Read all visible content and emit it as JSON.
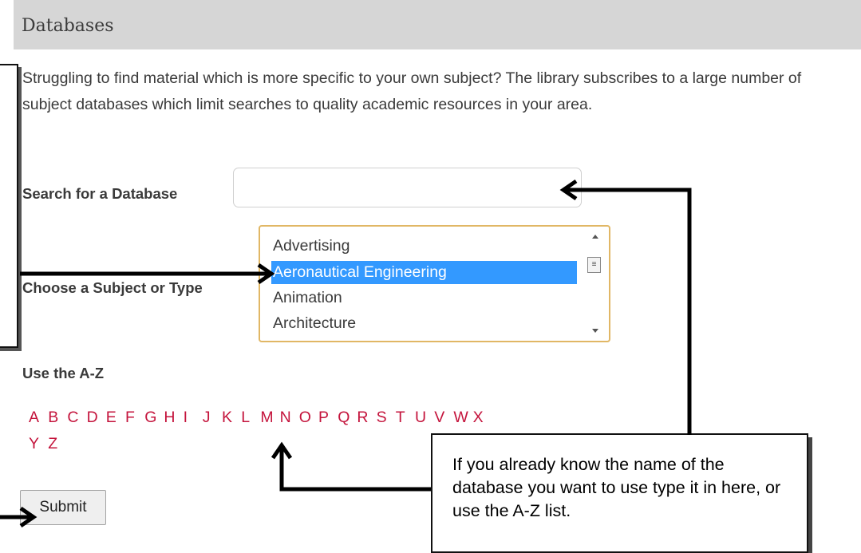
{
  "header": {
    "title": "Databases"
  },
  "intro": "Struggling to find material which is more specific to your own subject? The library subscribes to a large number of subject databases which limit searches to quality academic resources in your area.",
  "search": {
    "label": "Search for a Database",
    "value": "",
    "placeholder": ""
  },
  "subject": {
    "label": "Choose a Subject or Type",
    "options": [
      "Advertising",
      "Aeronautical Engineering",
      "Animation",
      "Architecture"
    ],
    "selected": "Aeronautical Engineering"
  },
  "az": {
    "label": "Use the A-Z",
    "letters": [
      "A",
      "B",
      "C",
      "D",
      "E",
      "F",
      "G",
      "H",
      "I",
      "J",
      "K",
      "L",
      "M",
      "N",
      "O",
      "P",
      "Q",
      "R",
      "S",
      "T",
      "U",
      "V",
      "W",
      "X",
      "Y",
      "Z"
    ]
  },
  "submit_label": "Submit",
  "callout": {
    "text": "If you already know the name of the database you want to use type it in here, or use the A-Z list."
  },
  "colors": {
    "header_bg": "#d6d6d6",
    "link": "#c4143c",
    "focus_border": "#e1b765",
    "selection": "#3399ff"
  }
}
